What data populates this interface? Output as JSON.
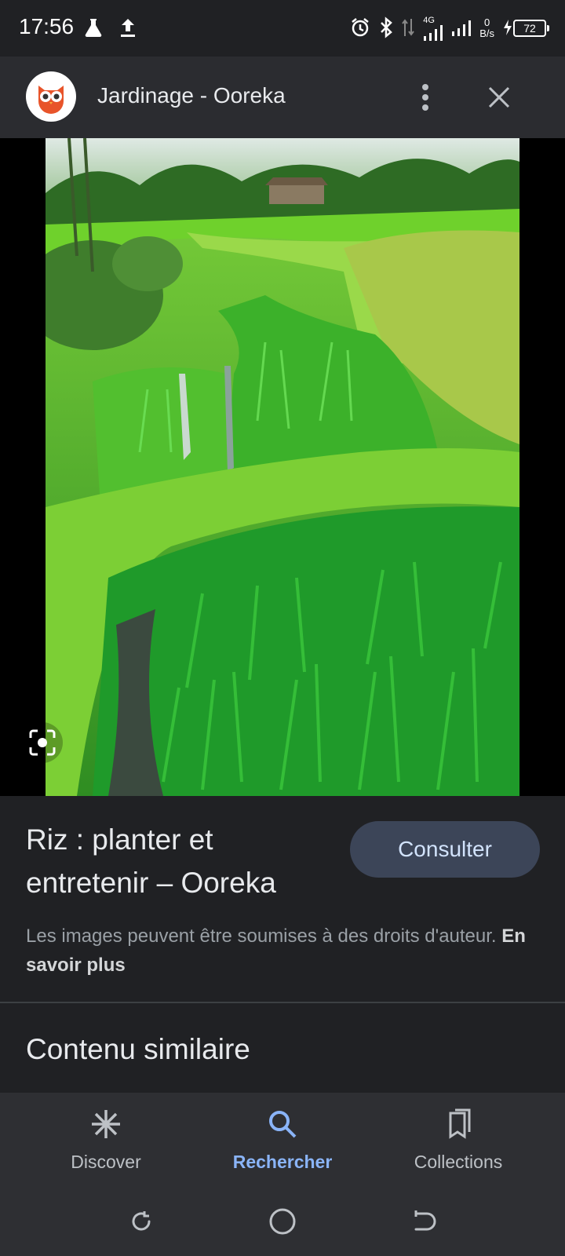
{
  "status_bar": {
    "time": "17:56",
    "network_type": "4G",
    "speed_value": "0",
    "speed_unit": "B/s",
    "battery": "72",
    "icons": [
      "flask-icon",
      "upload-icon",
      "alarm-icon",
      "bluetooth-icon",
      "data-arrows-icon",
      "signal-icon",
      "charging-icon",
      "battery-icon"
    ]
  },
  "header": {
    "title": "Jardinage - Ooreka",
    "logo_icon": "ooreka-owl-logo",
    "more_icon": "more-vert-icon",
    "close_icon": "close-icon"
  },
  "image": {
    "lens_icon": "lens-icon"
  },
  "result": {
    "title": "Riz : planter et entretenir – Ooreka",
    "visit_label": "Consulter",
    "copyright_text": "Les images peuvent être soumises à des droits d'auteur.",
    "learn_more": "En savoir plus"
  },
  "similar": {
    "heading": "Contenu similaire"
  },
  "bottom_nav": {
    "items": [
      {
        "label": "Discover",
        "icon": "asterisk-icon",
        "active": false
      },
      {
        "label": "Rechercher",
        "icon": "search-icon",
        "active": true
      },
      {
        "label": "Collections",
        "icon": "collections-icon",
        "active": false
      }
    ]
  },
  "colors": {
    "background": "#202124",
    "header": "#2b2c30",
    "accent": "#8ab4f8",
    "button": "#3c4558"
  }
}
